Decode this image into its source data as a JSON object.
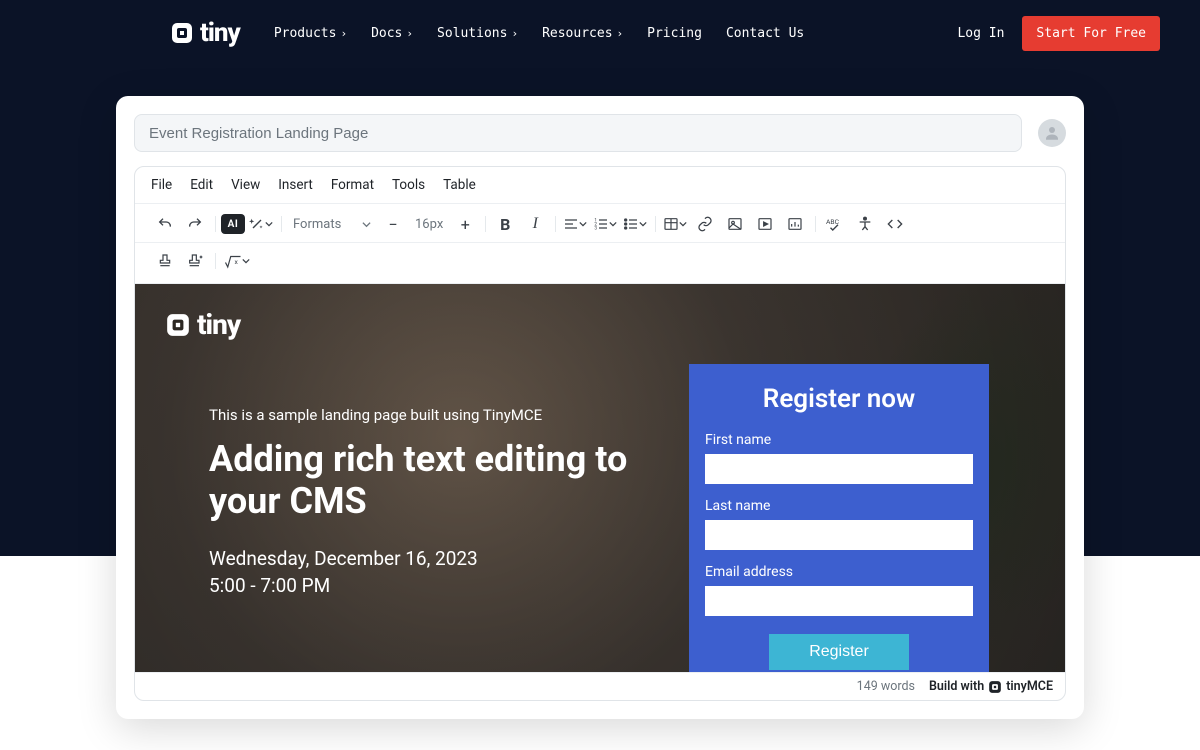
{
  "nav": {
    "brand": "tiny",
    "items": [
      "Products",
      "Docs",
      "Solutions",
      "Resources",
      "Pricing",
      "Contact Us"
    ],
    "items_chevron": [
      true,
      true,
      true,
      true,
      false,
      false
    ],
    "login": "Log In",
    "cta": "Start For Free"
  },
  "card": {
    "title_value": "Event Registration Landing Page"
  },
  "editor": {
    "menubar": [
      "File",
      "Edit",
      "View",
      "Insert",
      "Format",
      "Tools",
      "Table"
    ],
    "formats_label": "Formats",
    "fontsize": "16px",
    "ai_label": "AI"
  },
  "canvas": {
    "brand": "tiny",
    "subtitle": "This is a sample landing page built using TinyMCE",
    "headline": "Adding rich text editing to your CMS",
    "date": "Wednesday, December 16, 2023",
    "time": "5:00 - 7:00 PM",
    "register": {
      "title": "Register now",
      "first_name": "First name",
      "last_name": "Last name",
      "email": "Email address",
      "button": "Register"
    }
  },
  "statusbar": {
    "words": "149 words",
    "build_with": "Build with",
    "brand": "tinyMCE"
  }
}
